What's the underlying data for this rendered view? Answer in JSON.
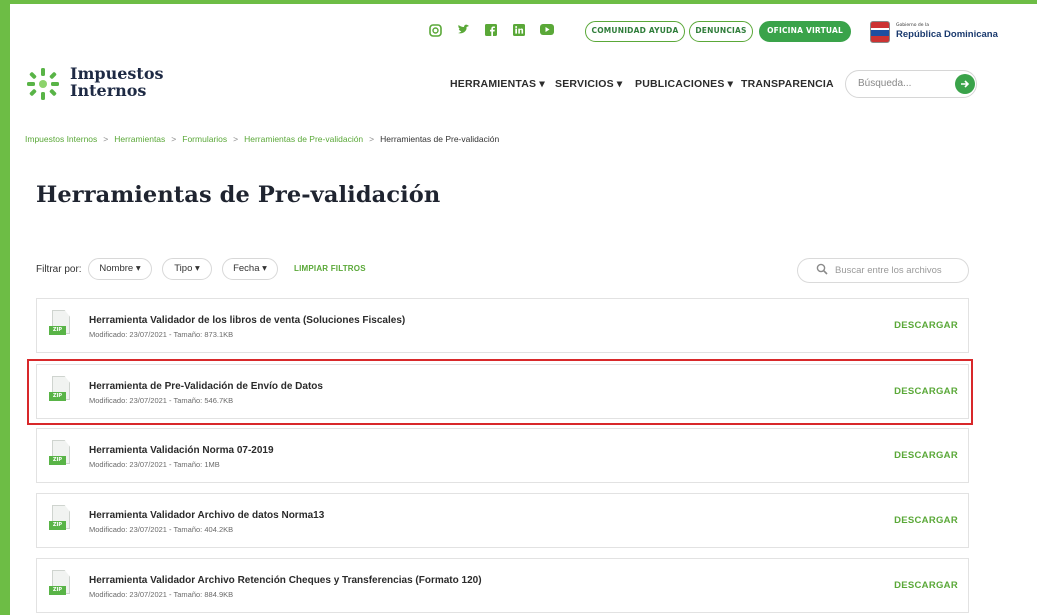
{
  "top_links": {
    "comunidad": "COMUNIDAD AYUDA",
    "denuncias": "DENUNCIAS",
    "oficina": "OFICINA VIRTUAL"
  },
  "gov": {
    "small": "Gobierno de la",
    "name": "República Dominicana"
  },
  "logo": {
    "line1": "Impuestos",
    "line2": "Internos"
  },
  "nav": {
    "herramientas": "HERRAMIENTAS",
    "servicios": "SERVICIOS",
    "publicaciones": "PUBLICACIONES",
    "transparencia": "TRANSPARENCIA",
    "search_placeholder": "Búsqueda..."
  },
  "breadcrumb": {
    "items": [
      "Impuestos Internos",
      "Herramientas",
      "Formularios",
      "Herramientas de Pre-validación"
    ],
    "current": "Herramientas de Pre-validación"
  },
  "page_title": "Herramientas de Pre-validación",
  "filters": {
    "label": "Filtrar por:",
    "nombre": "Nombre",
    "tipo": "Tipo",
    "fecha": "Fecha",
    "clear": "LIMPIAR FILTROS",
    "search_placeholder": "Buscar entre los archivos"
  },
  "files": [
    {
      "name": "Herramienta Validador de los libros de venta (Soluciones Fiscales)",
      "meta": "Modificado: 23/07/2021 - Tamaño: 873.1KB"
    },
    {
      "name": "Herramienta de Pre-Validación de Envío de Datos",
      "meta": "Modificado: 23/07/2021 - Tamaño: 546.7KB"
    },
    {
      "name": "Herramienta Validación Norma 07-2019",
      "meta": "Modificado: 23/07/2021 - Tamaño: 1MB"
    },
    {
      "name": "Herramienta Validador Archivo de datos Norma13",
      "meta": "Modificado: 23/07/2021 - Tamaño: 404.2KB"
    },
    {
      "name": "Herramienta Validador Archivo Retención Cheques y Transferencias (Formato 120)",
      "meta": "Modificado: 23/07/2021 - Tamaño: 884.9KB"
    }
  ],
  "file_icon_label": "ZIP",
  "download_label": "DESCARGAR",
  "colors": {
    "brand_green": "#5aa838",
    "button_green": "#3aa34a",
    "highlight_red": "#d8282a"
  },
  "icons": [
    "instagram-icon",
    "twitter-icon",
    "facebook-icon",
    "linkedin-icon",
    "youtube-icon",
    "search-icon",
    "arrow-right-icon",
    "chevron-down-icon",
    "zip-file-icon"
  ]
}
